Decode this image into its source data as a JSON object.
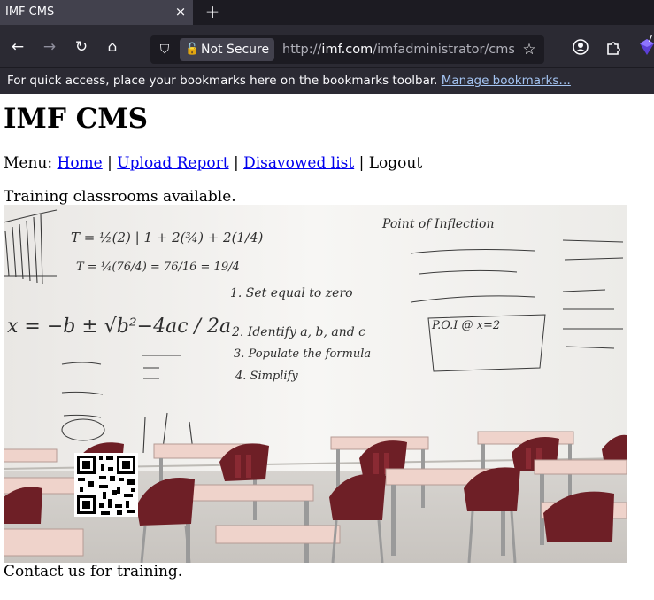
{
  "browser": {
    "tab_title": "IMF CMS",
    "tab_close": "×",
    "new_tab": "+",
    "security_label": "Not Secure",
    "url_prefix": "http://",
    "url_host": "imf.com",
    "url_path": "/imfadministrator/cms.p",
    "bookmarks_hint": "For quick access, place your bookmarks here on the bookmarks toolbar.",
    "manage_bookmarks": "Manage bookmarks…",
    "extension_badge": "7"
  },
  "page": {
    "heading": "IMF CMS",
    "menu_prefix": "Menu:",
    "menu": {
      "home": "Home",
      "upload_report": "Upload Report",
      "disavowed_list": "Disavowed list",
      "logout": "Logout",
      "separator": "|"
    },
    "intro_text": "Training classrooms available.",
    "footer_text": "Contact us for training."
  },
  "whiteboard": {
    "formula": "x = −b ± √b²−4ac / 2a",
    "point_of_inflection": "Point of Inflection",
    "steps": [
      "1. Set equal to zero",
      "2. Identify a, b, and c",
      "3. Populate the formula",
      "4. Simplify"
    ],
    "poi": "P.O.I @ x=2",
    "ex1": "T = ½(2) | 1 + 2(¾) + 2(1/4)",
    "ex2": "T = ¼(76/4) = 76/16 = 19/4"
  },
  "colors": {
    "tab_strip": "#1c1b22",
    "toolbar": "#2b2a33",
    "link": "#0000ee",
    "desk_chair": "#6e1f26",
    "desk_top": "#efd3cb"
  }
}
